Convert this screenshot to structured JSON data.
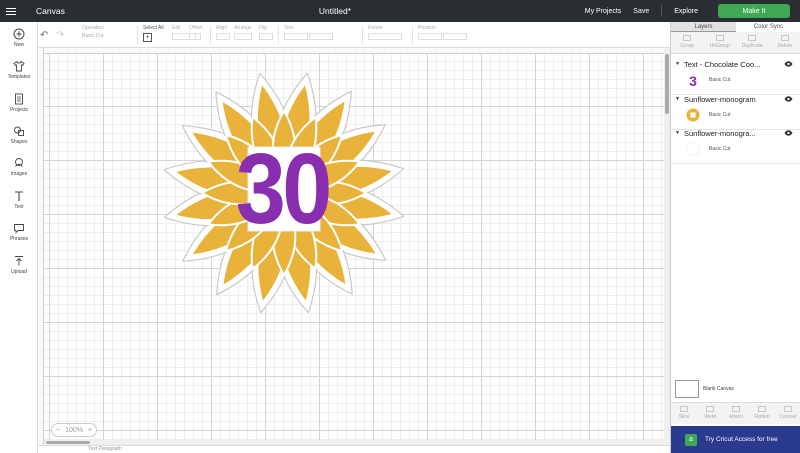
{
  "header": {
    "app_name": "Canvas",
    "document_title": "Untitled*",
    "my_projects": "My Projects",
    "save": "Save",
    "explore": "Explore",
    "make_it": "Make It"
  },
  "toolbar": {
    "operation_label": "Operation",
    "operation_value": "Basic Cut",
    "select_all": "Select All",
    "edit": "Edit",
    "offset": "Offset",
    "align": "Align",
    "arrange": "Arrange",
    "flip": "Flip",
    "size": "Size",
    "rotate": "Rotate",
    "position": "Position"
  },
  "sidebar": {
    "items": [
      {
        "label": "New",
        "icon": "plus-circle-icon"
      },
      {
        "label": "Templates",
        "icon": "tshirt-icon"
      },
      {
        "label": "Projects",
        "icon": "projects-icon"
      },
      {
        "label": "Shapes",
        "icon": "shapes-icon"
      },
      {
        "label": "Images",
        "icon": "image-icon"
      },
      {
        "label": "Text",
        "icon": "text-icon"
      },
      {
        "label": "Phrases",
        "icon": "speech-bubble-icon"
      },
      {
        "label": "Upload",
        "icon": "upload-icon"
      }
    ]
  },
  "canvas": {
    "zoom_minus": "−",
    "zoom_value": "100%",
    "zoom_plus": "+",
    "design_number": "30",
    "bottom_text": "Text    Paragraph"
  },
  "panel": {
    "tabs": [
      "Layers",
      "Color Sync"
    ],
    "actions": [
      "Group",
      "UnGroup",
      "Duplicate",
      "Delete"
    ],
    "layers": [
      {
        "name": "Text - Chocolate Coo...",
        "item": "Basic Cut",
        "thumb": "purple-3"
      },
      {
        "name": "Sunflower-monogram",
        "item": "Basic Cut",
        "thumb": "sunflower"
      },
      {
        "name": "Sunflower-monogra...",
        "item": "Basic Cut",
        "thumb": "white"
      }
    ],
    "blank_canvas": "Blank Canvas",
    "bottom_actions": [
      "Slice",
      "Weld",
      "Attach",
      "Flatten",
      "Contour"
    ],
    "try_access": "Try Cricut Access for free"
  },
  "colors": {
    "header_bg": "#2a2d31",
    "make_it": "#3ea855",
    "petal": "#e9b23a",
    "number": "#8a2eb0",
    "try_bg": "#2a3b8f"
  }
}
